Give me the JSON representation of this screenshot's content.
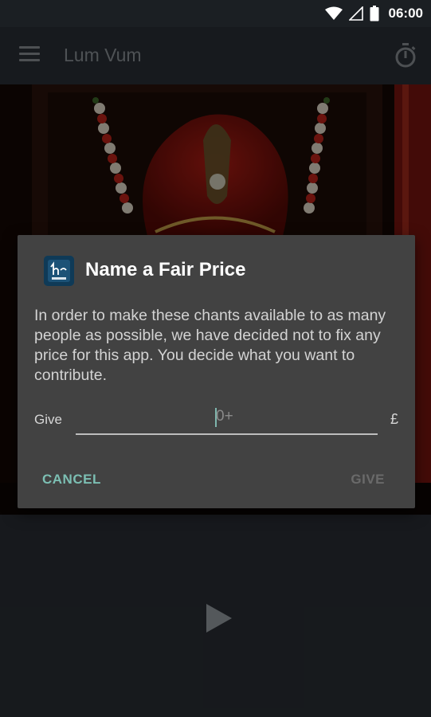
{
  "status_bar": {
    "time": "06:00"
  },
  "app_bar": {
    "title": "Lum Vum"
  },
  "dialog": {
    "title": "Name a Fair Price",
    "message": "In order to make these chants available to as many people as possible, we have decided not to fix any price for this app. You decide what you want to contribute.",
    "give_label": "Give",
    "input_placeholder": "0+",
    "currency": "£",
    "cancel_label": "CANCEL",
    "give_button_label": "GIVE"
  },
  "colors": {
    "accent": "#7cbfb3",
    "dialog_background": "#424242",
    "app_bar": "#2b3137"
  },
  "icons": [
    "wifi-icon",
    "signal-icon",
    "battery-icon",
    "menu-icon",
    "timer-icon",
    "app-icon",
    "play-icon"
  ]
}
